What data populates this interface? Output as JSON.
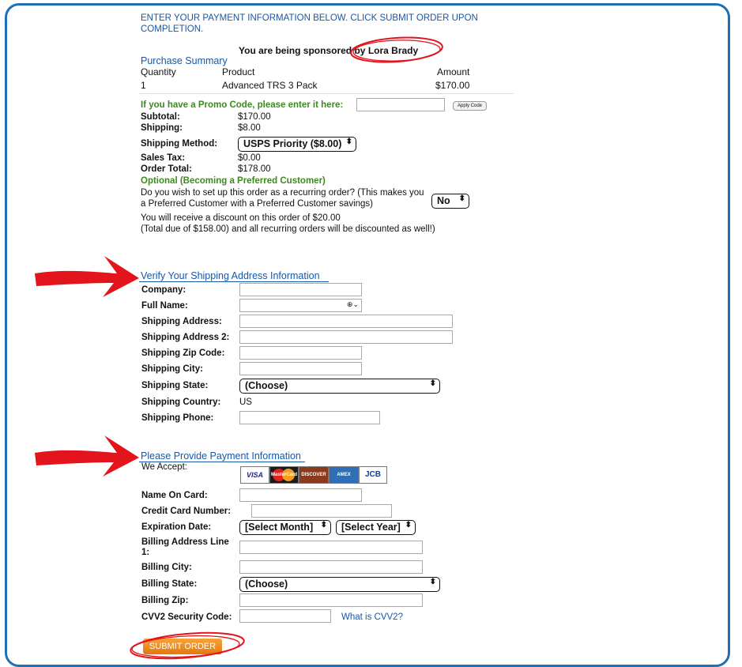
{
  "header": {
    "instruction_line1": "ENTER YOUR PAYMENT INFORMATION BELOW. CLICK SUBMIT ORDER UPON",
    "instruction_line2": "COMPLETION.",
    "sponsor_text": "You are being sponsored by",
    "sponsor_name": "Lora Brady"
  },
  "summary": {
    "title": "Purchase Summary",
    "col_quantity": "Quantity",
    "col_product": "Product",
    "col_amount": "Amount",
    "row_quantity": "1",
    "row_product": "Advanced TRS 3 Pack",
    "row_amount": "$170.00"
  },
  "promo": {
    "label": "If you have a Promo Code, please enter it here:",
    "input_value": "",
    "apply_label": "Apply Code"
  },
  "totals": {
    "subtotal_label": "Subtotal:",
    "subtotal_value": "$170.00",
    "shipping_label": "Shipping:",
    "shipping_value": "$8.00",
    "shipping_method_label": "Shipping Method:",
    "shipping_method_value": "USPS Priority ($8.00)",
    "sales_tax_label": "Sales Tax:",
    "sales_tax_value": "$0.00",
    "order_total_label": "Order Total:",
    "order_total_value": "$178.00"
  },
  "preferred": {
    "title": "Optional (Becoming a Preferred Customer)",
    "question_line1": "Do you wish to set up this order as a recurring order? (This makes you",
    "question_line2": "a Preferred Customer with a Preferred Customer savings)",
    "select_value": "No",
    "discount_line1": "You will receive a discount on this order of $20.00",
    "discount_line2": "(Total due of $158.00) and all recurring orders will be discounted as well!)"
  },
  "shipping": {
    "title": "Verify Your Shipping Address Information",
    "company_label": "Company:",
    "full_name_label": "Full Name:",
    "address_label": "Shipping Address:",
    "address2_label": "Shipping Address 2:",
    "zip_label": "Shipping Zip Code:",
    "city_label": "Shipping City:",
    "state_label": "Shipping State:",
    "state_value": "(Choose)",
    "country_label": "Shipping Country:",
    "country_value": "US",
    "phone_label": "Shipping Phone:"
  },
  "payment": {
    "title": "Please Provide Payment Information",
    "we_accept_label": "We Accept:",
    "cards": [
      "VISA",
      "MasterCard",
      "DISCOVER",
      "AMEX",
      "JCB"
    ],
    "name_label": "Name On Card:",
    "cc_label": "Credit Card Number:",
    "exp_label": "Expiration Date:",
    "exp_month_value": "[Select Month]",
    "exp_year_value": "[Select Year]",
    "billing_line1_label_a": "Billing Address Line",
    "billing_line1_label_b": "1:",
    "billing_city_label": "Billing City:",
    "billing_state_label": "Billing State:",
    "billing_state_value": "(Choose)",
    "billing_zip_label": "Billing Zip:",
    "cvv_label": "CVV2 Security Code:",
    "cvv_link": "What is CVV2?"
  },
  "submit_label": "SUBMIT ORDER",
  "colors": {
    "frame": "#1f6fb2",
    "heading_blue": "#1757a6",
    "promo_green": "#3c8a1d",
    "arrow_red": "#e3141b",
    "submit_orange": "#f0901f"
  }
}
